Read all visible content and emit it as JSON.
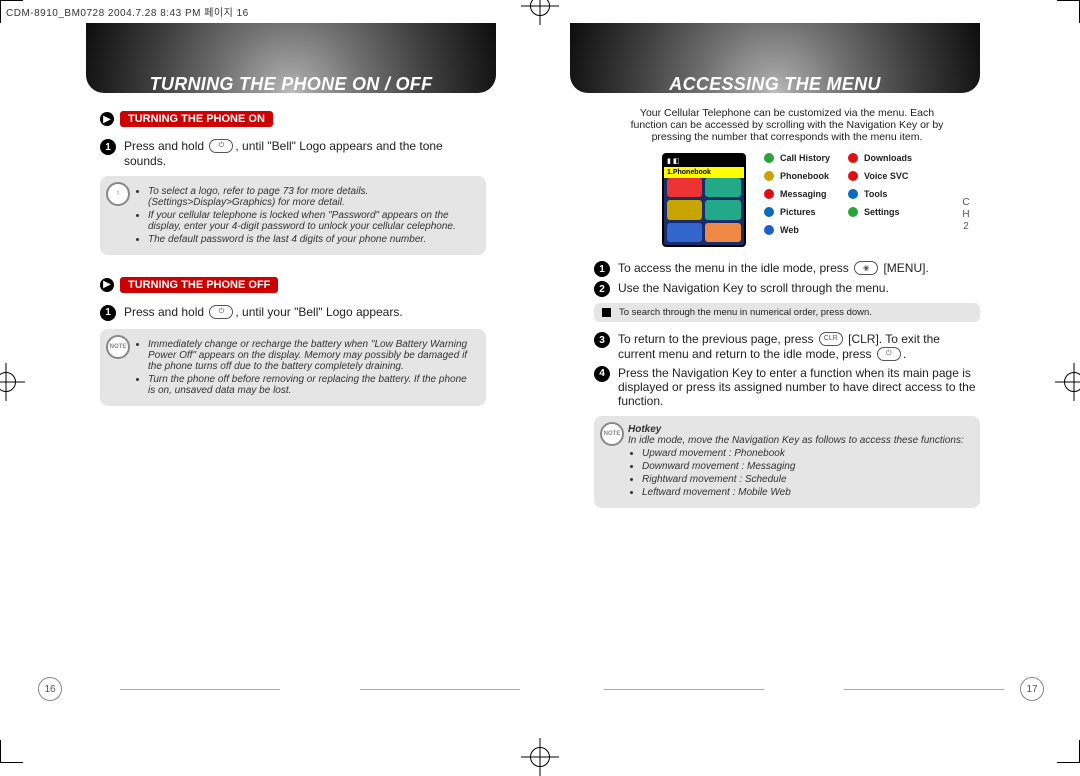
{
  "print_header": "CDM-8910_BM0728  2004.7.28 8:43 PM  페이지 16",
  "left_page": {
    "title": "TURNING THE PHONE ON / OFF",
    "ch_label": "C\nH\n2",
    "section_on": {
      "heading": "TURNING THE PHONE ON",
      "step1_a": "Press and hold ",
      "step1_b": ", until \"Bell\" Logo appears and the tone sounds.",
      "note_items": [
        "To select a logo, refer to page 73 for more details. (Settings>Display>Graphics) for more detail.",
        "If your cellular telephone is locked when \"Password\" appears on the display, enter your 4-digit password to unlock your cellular celephone.",
        "The default password is the last 4 digits of your phone number."
      ]
    },
    "section_off": {
      "heading": "TURNING THE PHONE OFF",
      "step1_a": "Press and hold ",
      "step1_b": ", until your \"Bell\" Logo appears.",
      "note_badge": "NOTE",
      "note_items": [
        "Immediately change or recharge the battery when \"Low Battery Warning Power Off\" appears on the display. Memory may possibly be damaged if the phone turns off due to the battery completely draining.",
        "Turn the phone off before removing or replacing the battery. If the phone is on, unsaved data may be lost."
      ]
    },
    "folio": "16"
  },
  "right_page": {
    "title": "ACCESSING THE MENU",
    "ch_label": "C\nH\n2",
    "intro": "Your Cellular Telephone can be customized via the menu. Each function can be accessed by scrolling with the Navigation Key or by pressing the number that corresponds with the menu item.",
    "phone_highlight": "1.Phonebook",
    "menu_col1": [
      {
        "label": "Call History",
        "color": "#2aa33a"
      },
      {
        "label": "Phonebook",
        "color": "#c7a400"
      },
      {
        "label": "Messaging",
        "color": "#d11"
      },
      {
        "label": "Pictures",
        "color": "#0a6abf"
      },
      {
        "label": "Web",
        "color": "#1e60c9"
      }
    ],
    "menu_col2": [
      {
        "label": "Downloads",
        "color": "#d11"
      },
      {
        "label": "Voice SVC",
        "color": "#d11"
      },
      {
        "label": "Tools",
        "color": "#0a6abf"
      },
      {
        "label": "Settings",
        "color": "#2aa33a"
      }
    ],
    "steps": {
      "s1_a": "To access the menu in the idle mode, press ",
      "s1_b": " [MENU].",
      "s2": "Use the Navigation Key to scroll through the menu.",
      "tiny": "To search through the menu in numerical order, press down.",
      "s3_a": "To return to the previous page, press ",
      "s3_b": " [CLR]. To exit the current menu and return to the idle mode, press ",
      "s3_c": ".",
      "s4": "Press the Navigation Key to enter a function when its main page is displayed or press its assigned number to have direct access to the function."
    },
    "hotkey": {
      "badge": "NOTE",
      "title": "Hotkey",
      "lead": "In idle mode, move the Navigation Key as follows to access these functions:",
      "items": [
        "Upward movement : Phonebook",
        "Downward movement : Messaging",
        "Rightward movement : Schedule",
        "Leftward movement : Mobile Web"
      ]
    },
    "folio": "17"
  }
}
